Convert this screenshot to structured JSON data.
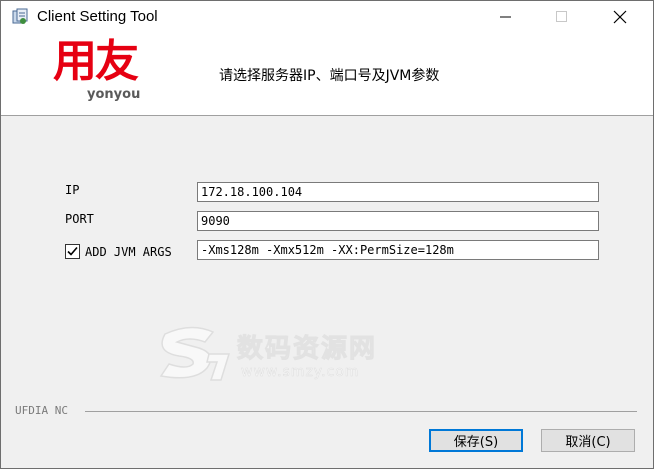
{
  "window": {
    "title": "Client Setting Tool"
  },
  "header": {
    "logo_cn": "用友",
    "logo_en": "yonyou",
    "instruction": "请选择服务器IP、端口号及JVM参数"
  },
  "form": {
    "ip_label": "IP",
    "ip_value": "172.18.100.104",
    "port_label": "PORT",
    "port_value": "9090",
    "jvm_label": "ADD JVM ARGS",
    "jvm_checked": true,
    "jvm_value": "-Xms128m -Xmx512m -XX:PermSize=128m"
  },
  "watermark": {
    "text_cn": "数码资源网",
    "url": "www.smzy.com"
  },
  "footer": {
    "group_label": "UFDIA NC",
    "save_label": "保存(S)",
    "cancel_label": "取消(C)"
  },
  "colors": {
    "logo_red": "#e60012",
    "panel_bg": "#f0f0f0",
    "focus_blue": "#0078d7"
  }
}
